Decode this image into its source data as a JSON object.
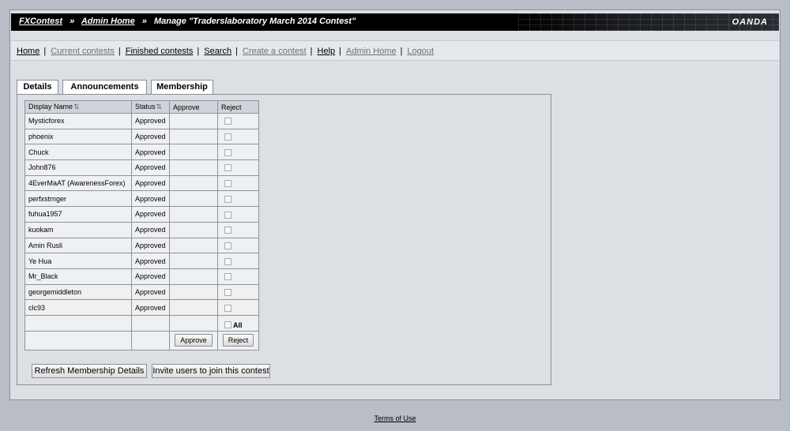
{
  "header": {
    "crumb_root": "FXContest",
    "crumb_admin": "Admin Home",
    "separator": "»",
    "crumb_current": "Manage \"Traderslaboratory March 2014 Contest\"",
    "brand": "OANDA"
  },
  "nav": {
    "items": [
      {
        "label": "Home"
      },
      {
        "label": "Current contests"
      },
      {
        "label": "Finished contests"
      },
      {
        "label": "Search"
      },
      {
        "label": "Create a contest"
      },
      {
        "label": "Help"
      },
      {
        "label": "Admin Home"
      },
      {
        "label": "Logout"
      }
    ],
    "pipe": "|"
  },
  "tabs": [
    {
      "label": "Details"
    },
    {
      "label": "Announcements"
    },
    {
      "label": "Membership"
    }
  ],
  "table": {
    "headers": {
      "name": "Display Name",
      "status": "Status",
      "approve": "Approve",
      "reject": "Reject"
    },
    "sort_glyph": "⇅",
    "rows": [
      {
        "name": "Mysticforex",
        "status": "Approved"
      },
      {
        "name": "phoenix",
        "status": "Approved"
      },
      {
        "name": "Chuck",
        "status": "Approved"
      },
      {
        "name": "John876",
        "status": "Approved"
      },
      {
        "name": "4EverMaAT (AwarenessForex)",
        "status": "Approved"
      },
      {
        "name": "perfxstrnger",
        "status": "Approved"
      },
      {
        "name": "fuhua1957",
        "status": "Approved"
      },
      {
        "name": "kuokam",
        "status": "Approved"
      },
      {
        "name": "Amin Rusli",
        "status": "Approved"
      },
      {
        "name": "Ye Hua",
        "status": "Approved"
      },
      {
        "name": "Mr_Black",
        "status": "Approved"
      },
      {
        "name": "georgemiddleton",
        "status": "Approved"
      },
      {
        "name": "clc93",
        "status": "Approved"
      }
    ],
    "all_label": "All",
    "approve_btn": "Approve",
    "reject_btn": "Reject"
  },
  "buttons": {
    "refresh": "Refresh Membership Details",
    "invite": "Invite users to join this contest"
  },
  "footer": {
    "terms": "Terms of Use"
  }
}
